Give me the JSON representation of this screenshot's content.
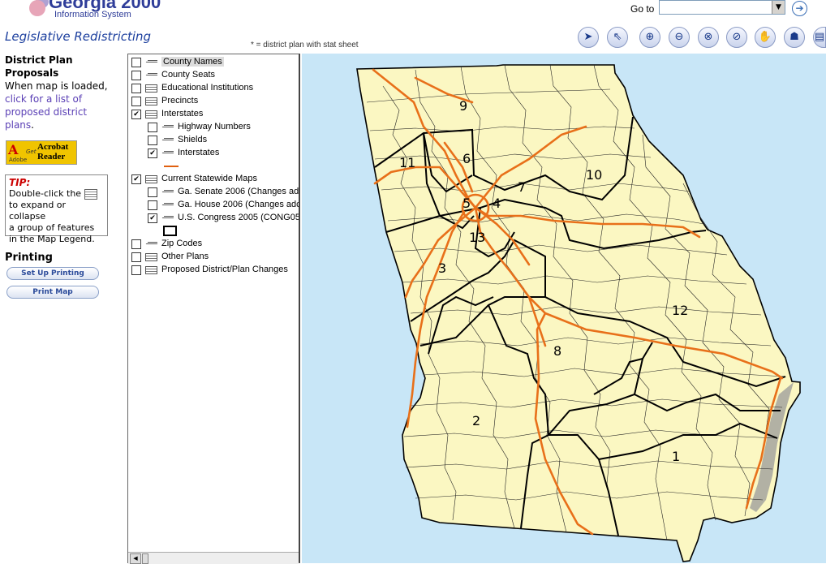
{
  "header": {
    "brand_title": "Georgia 2000",
    "brand_subtitle": "Information System",
    "goto_label": "Go to",
    "goto_value": "",
    "app_title": "Legislative Redistricting",
    "note": "* = district plan with stat sheet"
  },
  "toolbar": {
    "icons": [
      "select-arrow-icon",
      "select-pointer-icon",
      "zoom-in-icon",
      "zoom-out-icon",
      "zoom-extent-icon",
      "zoom-previous-icon",
      "pan-hand-icon",
      "identify-georgia-icon",
      "print-icon"
    ]
  },
  "left": {
    "heading_line1": "District Plan",
    "heading_line2": "Proposals",
    "loaded_text": "When map is loaded,",
    "link_line1": "click for a list of",
    "link_line2": "proposed district",
    "link_line3": "plans",
    "link_period": ".",
    "acrobat_get": "Get",
    "acrobat_adobe": "Adobe",
    "acrobat_name1": "Acrobat",
    "acrobat_name2": "Reader",
    "tip_title": "TIP:",
    "tip_line1": "Double-click the",
    "tip_line2": "to expand or collapse",
    "tip_line3": "a group of features",
    "tip_line4": "in the Map Legend.",
    "printing_heading": "Printing",
    "setup_printing": "Set Up Printing",
    "print_map": "Print Map"
  },
  "legend": {
    "items": [
      {
        "label": "County Names",
        "checked": false,
        "icon": "line",
        "indent": 0,
        "highlight": true
      },
      {
        "label": "County Seats",
        "checked": false,
        "icon": "line",
        "indent": 0
      },
      {
        "label": "Educational Institutions",
        "checked": false,
        "icon": "group",
        "indent": 0
      },
      {
        "label": "Precincts",
        "checked": false,
        "icon": "group",
        "indent": 0
      },
      {
        "label": "Interstates",
        "checked": true,
        "icon": "group",
        "indent": 0
      },
      {
        "label": "Highway Numbers",
        "checked": false,
        "icon": "line",
        "indent": 1
      },
      {
        "label": "Shields",
        "checked": false,
        "icon": "line",
        "indent": 1
      },
      {
        "label": "Interstates",
        "checked": true,
        "icon": "line",
        "indent": 1
      },
      {
        "label": "Current Statewide Maps",
        "checked": true,
        "icon": "group",
        "indent": 0
      },
      {
        "label": "Ga. Senate 2006 (Changes ad",
        "checked": false,
        "icon": "line",
        "indent": 1
      },
      {
        "label": "Ga. House 2006 (Changes adc",
        "checked": false,
        "icon": "line",
        "indent": 1
      },
      {
        "label": "U.S. Congress 2005 (CONG05",
        "checked": true,
        "icon": "line",
        "indent": 1
      },
      {
        "label": "Zip Codes",
        "checked": false,
        "icon": "line",
        "indent": 0
      },
      {
        "label": "Other Plans",
        "checked": false,
        "icon": "group",
        "indent": 0
      },
      {
        "label": "Proposed District/Plan Changes",
        "checked": false,
        "icon": "group",
        "indent": 0
      }
    ]
  },
  "map": {
    "district_labels": [
      "9",
      "11",
      "6",
      "10",
      "5",
      "7",
      "4",
      "3",
      "12",
      "8",
      "2",
      "1",
      "13"
    ],
    "colors": {
      "land": "#fbf7c2",
      "water": "#c8e6f7",
      "interstate": "#e8701a",
      "border": "#000000"
    }
  }
}
